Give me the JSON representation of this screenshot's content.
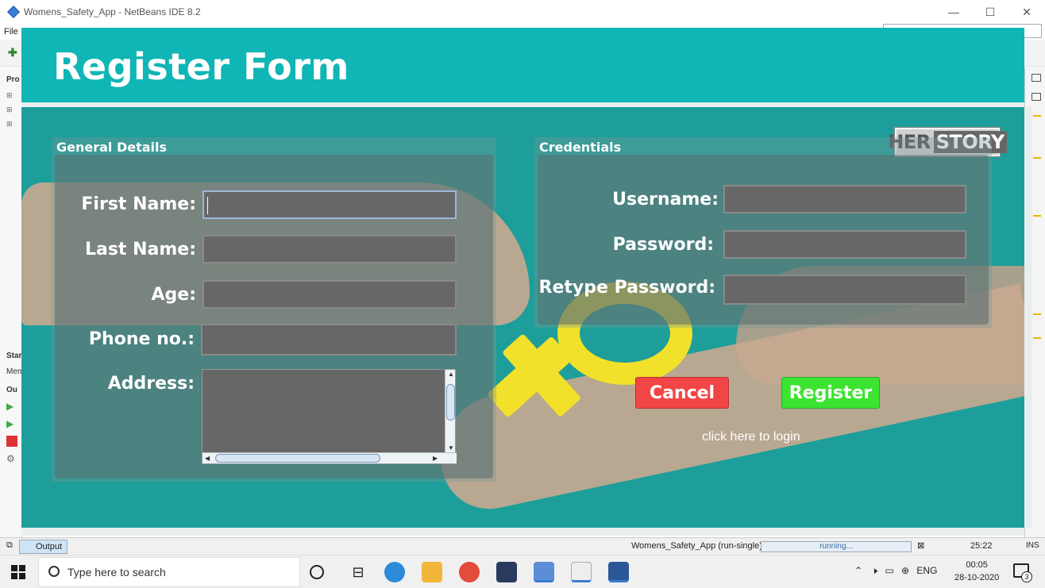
{
  "window": {
    "title": "Womens_Safety_App - NetBeans IDE 8.2",
    "minimize": "—",
    "maximize": "☐",
    "close": "✕"
  },
  "menubar": {
    "first_item": "File"
  },
  "left_panel": {
    "projects_label": "Pro",
    "start_label": "Star",
    "mem_label": "Mem",
    "output_label": "Ou"
  },
  "form": {
    "title": "Register Form",
    "general_details_title": "General Details",
    "credentials_title": "Credentials",
    "logo": {
      "her": "HER",
      "story": "STORY"
    },
    "fields": {
      "first_name_label": "First Name:",
      "last_name_label": "Last Name:",
      "age_label": "Age:",
      "phone_label": "Phone no.:",
      "address_label": "Address:",
      "username_label": "Username:",
      "password_label": "Password:",
      "retype_password_label": "Retype Password:"
    },
    "values": {
      "first_name": "",
      "last_name": "",
      "age": "",
      "phone": "",
      "address": "",
      "username": "",
      "password": "",
      "retype_password": ""
    },
    "cancel_button": "Cancel",
    "register_button": "Register",
    "login_link": "click here to login",
    "colors": {
      "header": "#10b5b5",
      "cancel": "#f24545",
      "register": "#3ce331",
      "emblem": "#f2e12a"
    }
  },
  "statusbar": {
    "output_tab": "Output",
    "project": "Womens_Safety_App (run-single)",
    "progress_text": "running...",
    "position": "25:22",
    "mode": "INS"
  },
  "taskbar": {
    "search_placeholder": "Type here to search",
    "language": "ENG",
    "time": "00:05",
    "date": "28-10-2020",
    "notification_count": "3"
  }
}
